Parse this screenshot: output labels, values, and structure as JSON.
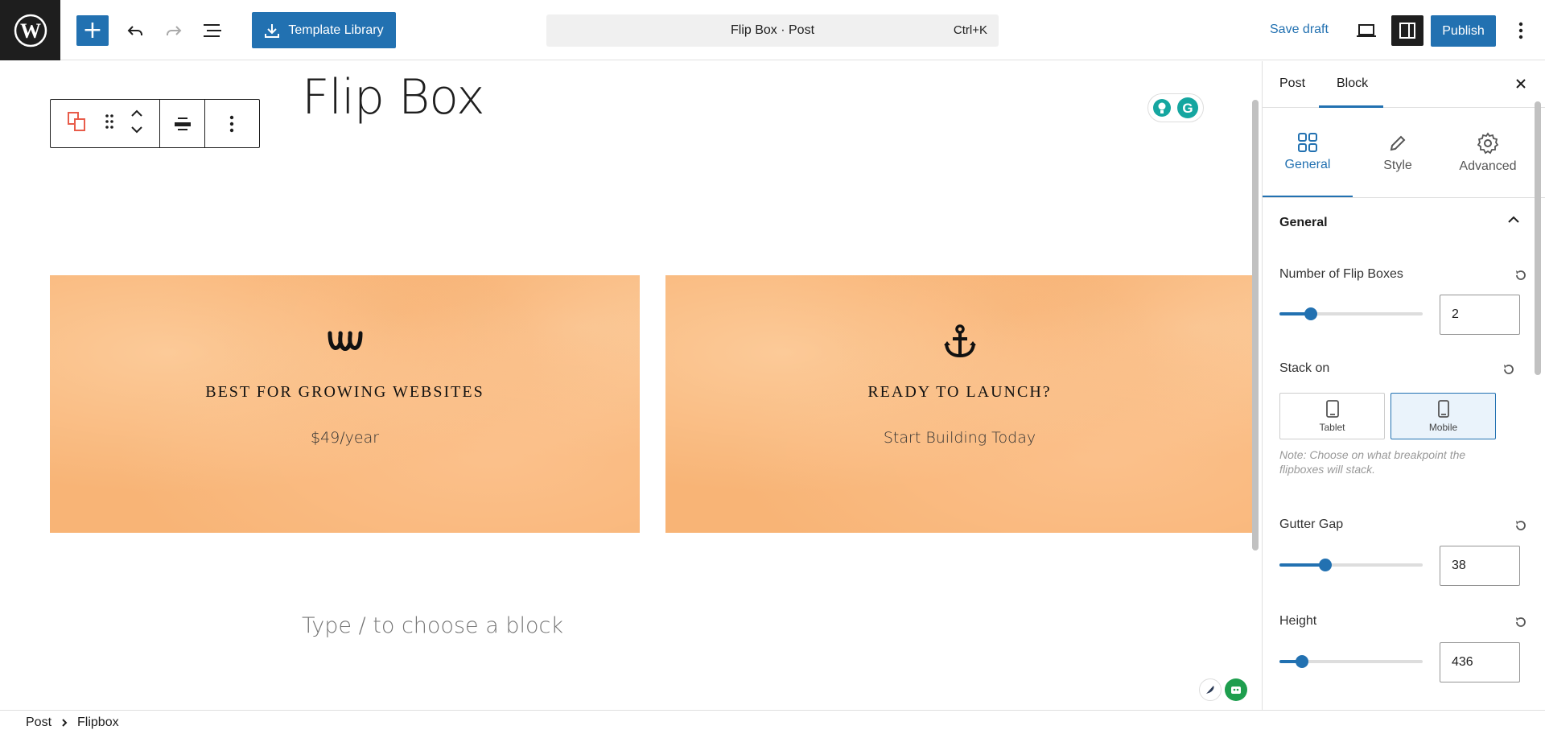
{
  "topbar": {
    "template_library_label": "Template Library",
    "document_title": "Flip Box · Post",
    "shortcut": "Ctrl+K",
    "save_draft_label": "Save draft",
    "publish_label": "Publish"
  },
  "editor": {
    "post_title": "Flip Box",
    "placeholder": "Type / to choose a block",
    "flipboxes": [
      {
        "icon": "weebly-logo-icon",
        "title": "BEST FOR GROWING WEBSITES",
        "subtitle": "$49/year"
      },
      {
        "icon": "anchor-icon",
        "title": "READY TO LAUNCH?",
        "subtitle": "Start Building Today"
      }
    ],
    "flipbox_color": "#f8b476"
  },
  "sidebar": {
    "tabs": [
      "Post",
      "Block"
    ],
    "active_tab": "Block",
    "subtabs": [
      "General",
      "Style",
      "Advanced"
    ],
    "active_subtab": "General",
    "panel_title": "General",
    "number_label": "Number of Flip Boxes",
    "number_value": "2",
    "number_fraction": 0.22,
    "stack_label": "Stack on",
    "stack_options": [
      "Tablet",
      "Mobile"
    ],
    "stack_selected": "Mobile",
    "stack_note": "Note: Choose on what breakpoint the flipboxes will stack.",
    "gutter_label": "Gutter Gap",
    "gutter_value": "38",
    "gutter_fraction": 0.32,
    "height_label": "Height",
    "height_value": "436",
    "height_fraction": 0.16
  },
  "breadcrumb": [
    "Post",
    "Flipbox"
  ],
  "colors": {
    "accent": "#2271b1",
    "dark": "#1e1e1e"
  }
}
